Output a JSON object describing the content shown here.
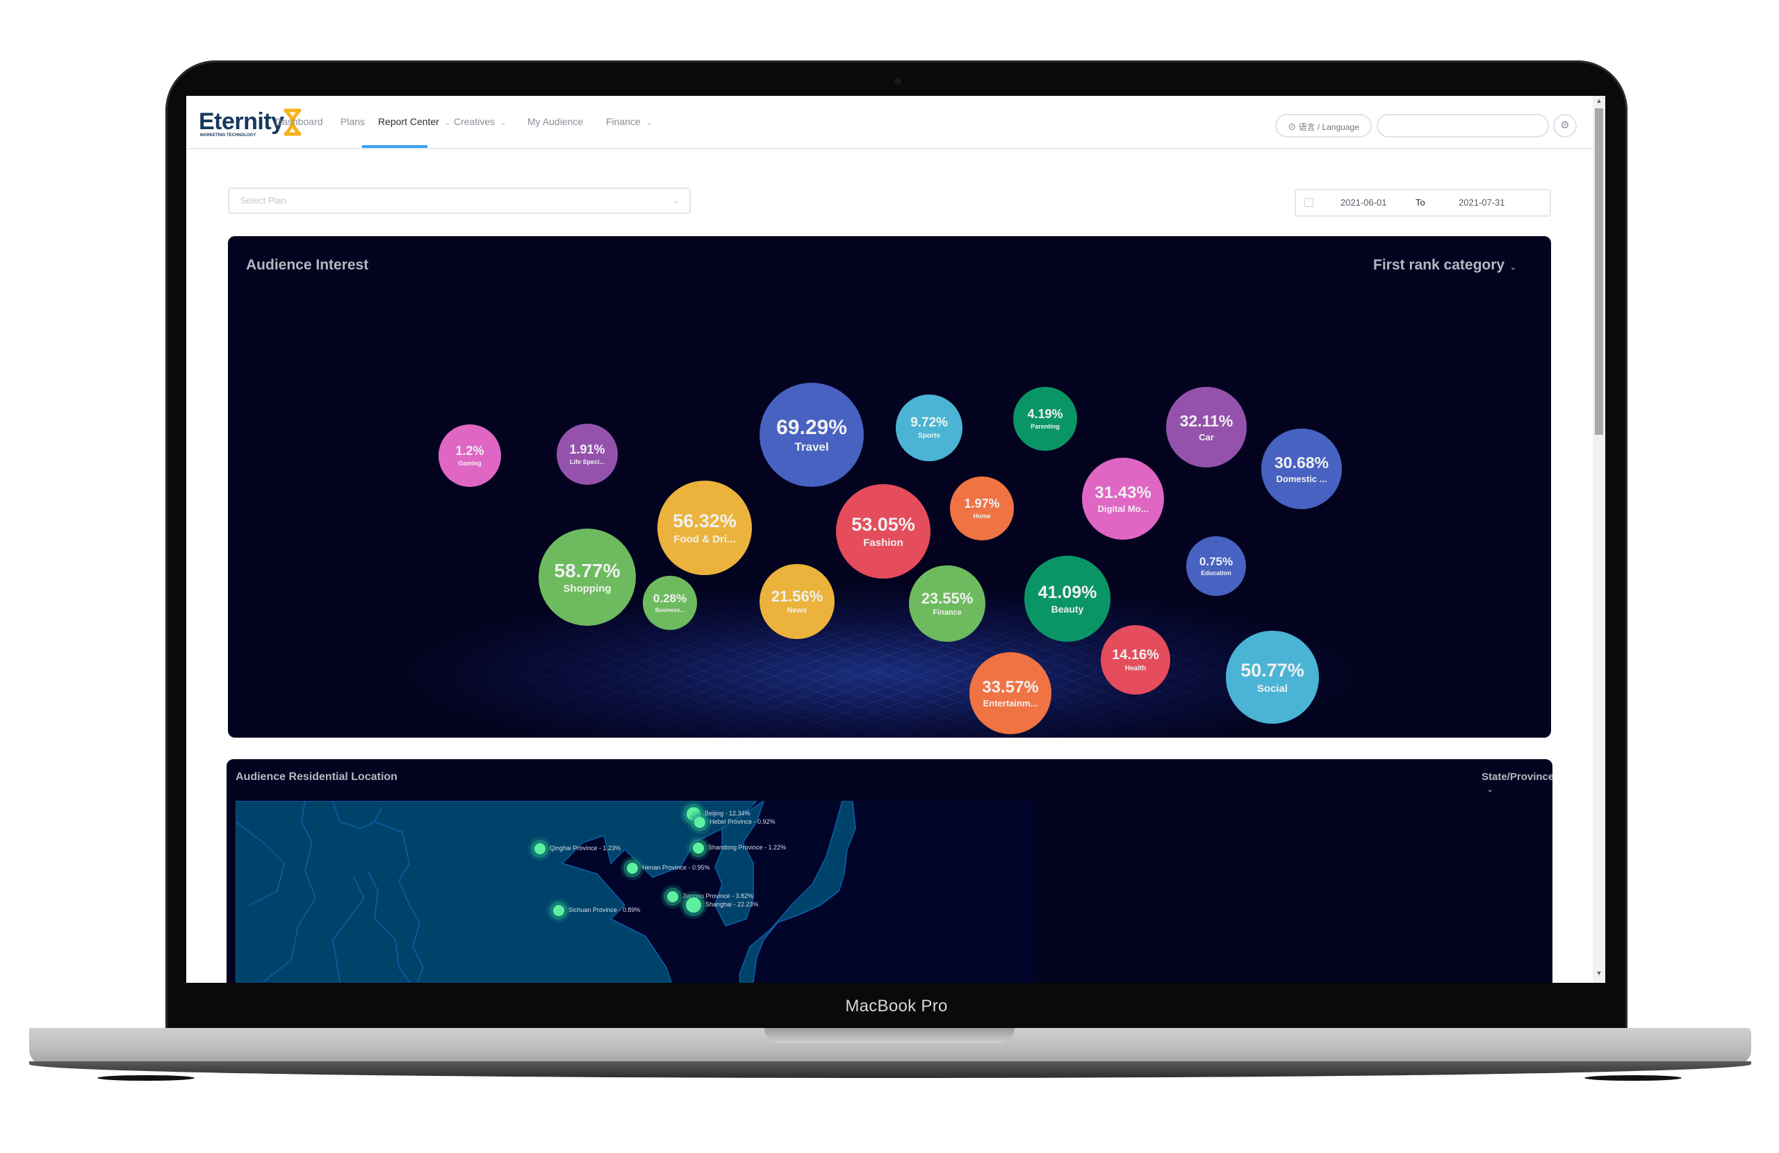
{
  "device": {
    "label": "MacBook Pro"
  },
  "nav": {
    "logo_text": "Eternity",
    "logo_subtext": "MARKETING TECHNOLOGY",
    "items": [
      {
        "label": "Dashboard",
        "has_dropdown": false,
        "active": false
      },
      {
        "label": "Plans",
        "has_dropdown": false,
        "active": false
      },
      {
        "label": "Report Center",
        "has_dropdown": true,
        "active": true
      },
      {
        "label": "Creatives",
        "has_dropdown": true,
        "active": false
      },
      {
        "label": "My Audience",
        "has_dropdown": false,
        "active": false
      },
      {
        "label": "Finance",
        "has_dropdown": true,
        "active": false
      }
    ],
    "language_button": "语言 / Language",
    "search_value": "",
    "accent_color": "#3aa0f0"
  },
  "filters": {
    "plan_select_placeholder": "Select Plan",
    "date_from": "2021-06-01",
    "date_separator": "To",
    "date_to": "2021-07-31"
  },
  "audience_interest": {
    "title": "Audience Interest",
    "dropdown_label": "First rank category"
  },
  "chart_data": {
    "type": "bubble",
    "title": "Audience Interest",
    "legend": "none",
    "series": [
      {
        "label": "Gaming",
        "display_label": "Gaming",
        "value": 1.2,
        "color": "#e066c4"
      },
      {
        "label": "Life Speci...",
        "display_label": "Life Speci...",
        "value": 1.91,
        "color": "#9452ad"
      },
      {
        "label": "Travel",
        "display_label": "Travel",
        "value": 69.29,
        "color": "#4762c1"
      },
      {
        "label": "Sports",
        "display_label": "Sports",
        "value": 9.72,
        "color": "#4bb4d4"
      },
      {
        "label": "Parenting",
        "display_label": "Parenting",
        "value": 4.19,
        "color": "#0a9566"
      },
      {
        "label": "Car",
        "display_label": "Car",
        "value": 32.11,
        "color": "#9452ad"
      },
      {
        "label": "Domestic ...",
        "display_label": "Domestic ...",
        "value": 30.68,
        "color": "#4762c1"
      },
      {
        "label": "Digital Mo...",
        "display_label": "Digital Mo...",
        "value": 31.43,
        "color": "#e066c4"
      },
      {
        "label": "Home",
        "display_label": "Home",
        "value": 1.97,
        "color": "#f07343"
      },
      {
        "label": "Fashion",
        "display_label": "Fashion",
        "value": 53.05,
        "color": "#e54c5c"
      },
      {
        "label": "Food & Dri...",
        "display_label": "Food & Dri...",
        "value": 56.32,
        "color": "#ebb33b"
      },
      {
        "label": "Shopping",
        "display_label": "Shopping",
        "value": 58.77,
        "color": "#6dbb5e"
      },
      {
        "label": "Business...",
        "display_label": "Business...",
        "value": 0.28,
        "color": "#6dbb5e"
      },
      {
        "label": "News",
        "display_label": "News",
        "value": 21.56,
        "color": "#ebb33b"
      },
      {
        "label": "Finance",
        "display_label": "Finance",
        "value": 23.55,
        "color": "#6dbb5e"
      },
      {
        "label": "Beauty",
        "display_label": "Beauty",
        "value": 41.09,
        "color": "#0a9566"
      },
      {
        "label": "Education",
        "display_label": "Education",
        "value": 0.75,
        "color": "#4762c1"
      },
      {
        "label": "Health",
        "display_label": "Health",
        "value": 14.16,
        "color": "#e54c5c"
      },
      {
        "label": "Entertainm...",
        "display_label": "Entertainm...",
        "value": 33.57,
        "color": "#f07343"
      },
      {
        "label": "Social",
        "display_label": "Social",
        "value": 50.77,
        "color": "#4bb4d4"
      }
    ]
  },
  "residential_location": {
    "title": "Audience Residential Location",
    "dropdown_label": "State/Province",
    "points": [
      {
        "name": "Beijing",
        "value": "12.34%"
      },
      {
        "name": "Hebei Province",
        "value": "0.92%"
      },
      {
        "name": "Qinghai Province",
        "value": "1.23%"
      },
      {
        "name": "Shandong Province",
        "value": "1.22%"
      },
      {
        "name": "Henan Province",
        "value": "0.95%"
      },
      {
        "name": "Jiangsu Province",
        "value": "3.82%"
      },
      {
        "name": "Shanghai",
        "value": "22.23%"
      },
      {
        "name": "Sichuan Province",
        "value": "0.89%"
      }
    ]
  }
}
